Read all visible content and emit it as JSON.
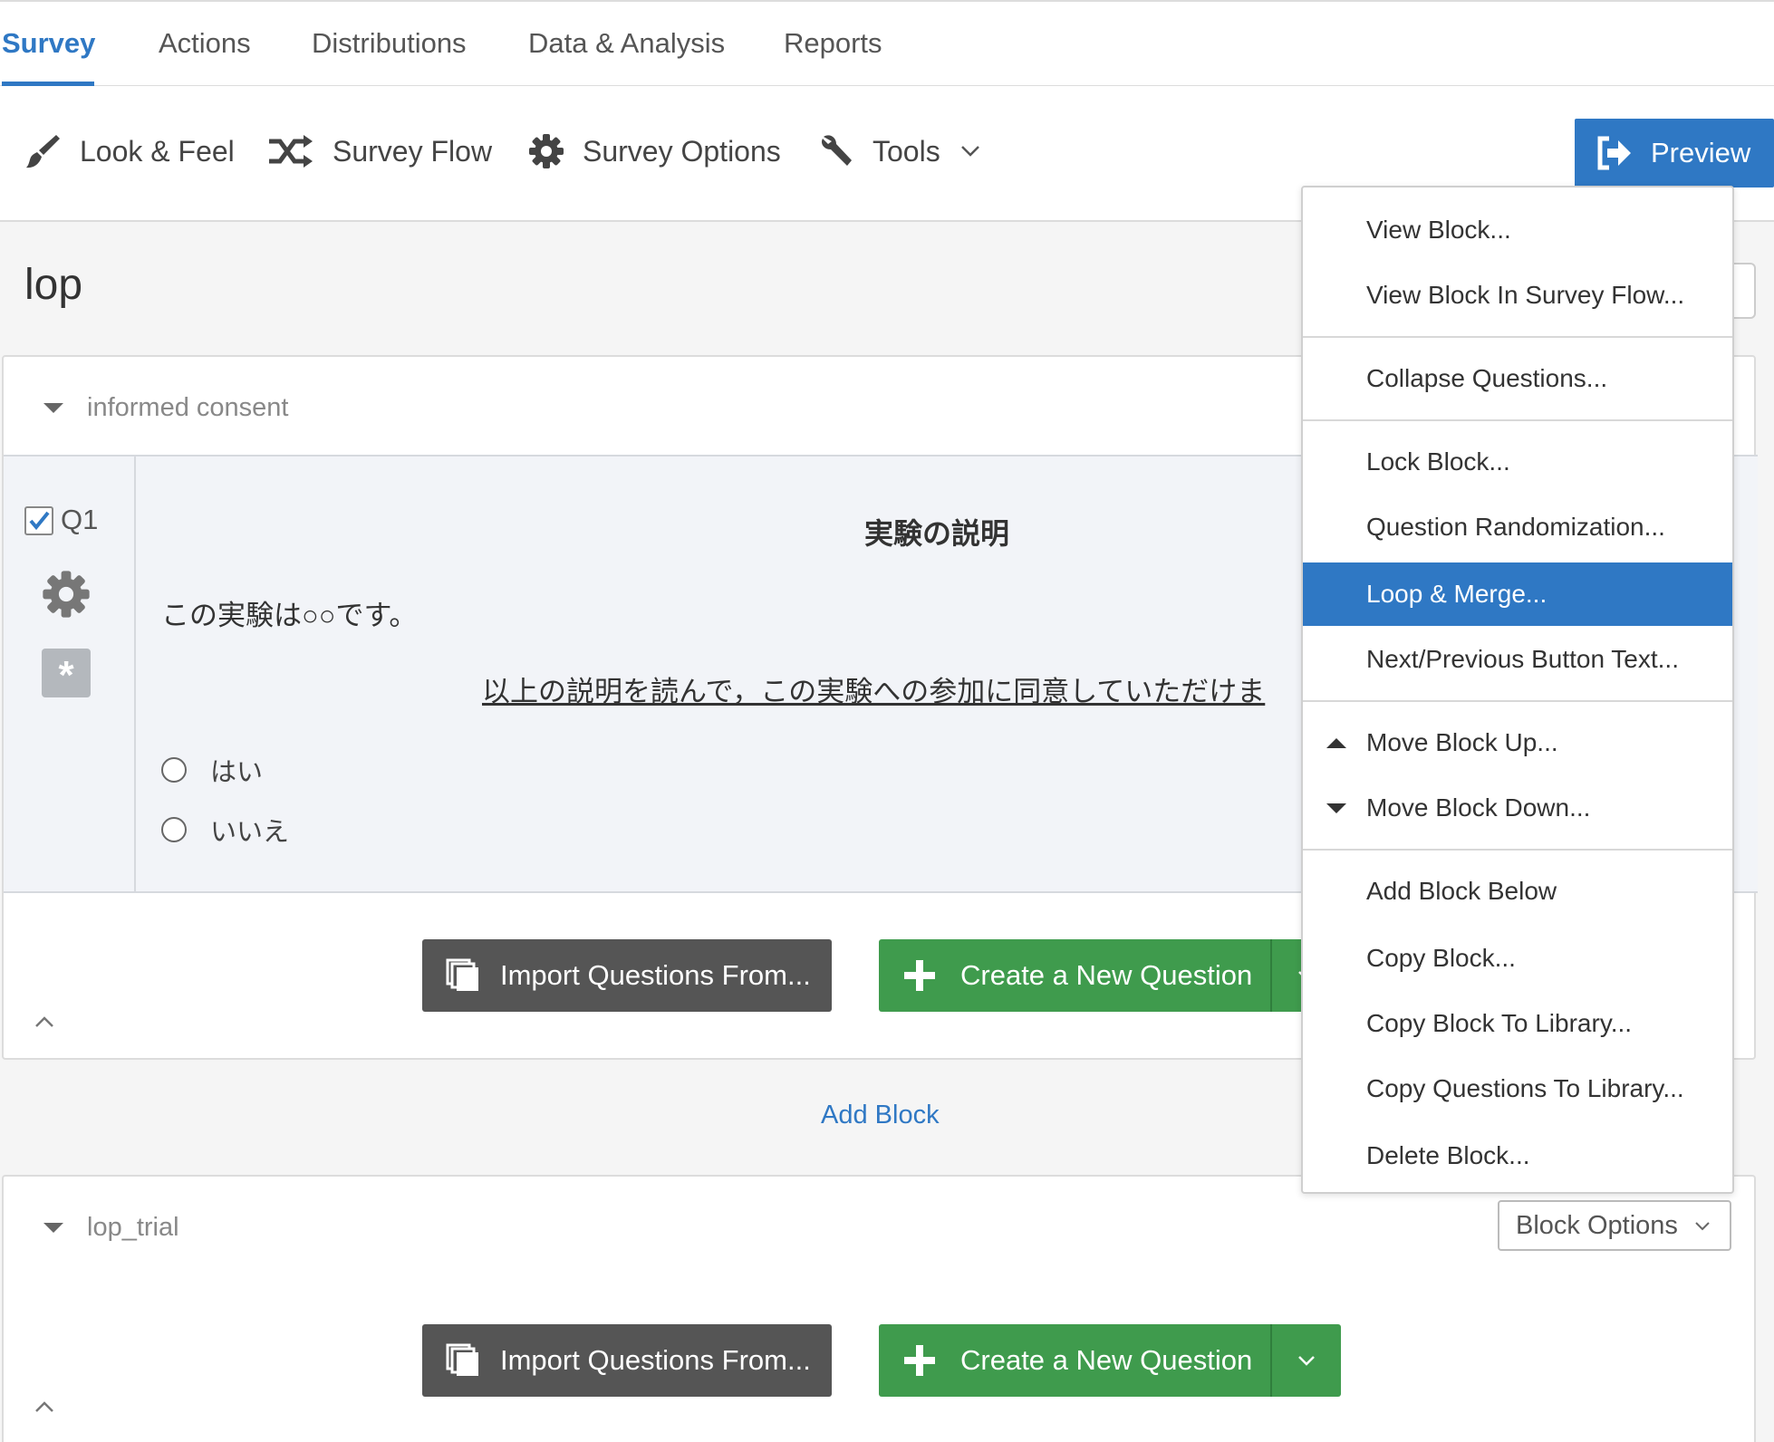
{
  "tabs": {
    "survey": "Survey",
    "actions": "Actions",
    "distributions": "Distributions",
    "data_analysis": "Data & Analysis",
    "reports": "Reports"
  },
  "toolbar": {
    "look_feel": "Look & Feel",
    "survey_flow": "Survey Flow",
    "survey_options": "Survey Options",
    "tools": "Tools",
    "preview": "Preview"
  },
  "page_title": "lop",
  "block1": {
    "name": "informed consent",
    "question": {
      "label": "Q1",
      "checked": true,
      "heading": "実験の説明",
      "body": "この実験は○○です。",
      "ask": "以上の説明を読んで，この実験への参加に同意していただけま",
      "options": [
        "はい",
        "いいえ"
      ]
    },
    "import_button": "Import Questions From...",
    "create_button": "Create a New Question"
  },
  "add_block": "Add Block",
  "block2": {
    "name": "lop_trial",
    "block_options": "Block Options",
    "import_button": "Import Questions From...",
    "create_button": "Create a New Question"
  },
  "menu": {
    "items": [
      "View Block...",
      "View Block In Survey Flow...",
      "Collapse Questions...",
      "Lock Block...",
      "Question Randomization...",
      "Loop & Merge...",
      "Next/Previous Button Text...",
      "Move Block Up...",
      "Move Block Down...",
      "Add Block Below",
      "Copy Block...",
      "Copy Block To Library...",
      "Copy Questions To Library...",
      "Delete Block..."
    ],
    "highlighted": "Loop & Merge..."
  },
  "colors": {
    "accent": "#2f78c4",
    "green": "#3f9b4d",
    "dark_button": "#555555"
  }
}
